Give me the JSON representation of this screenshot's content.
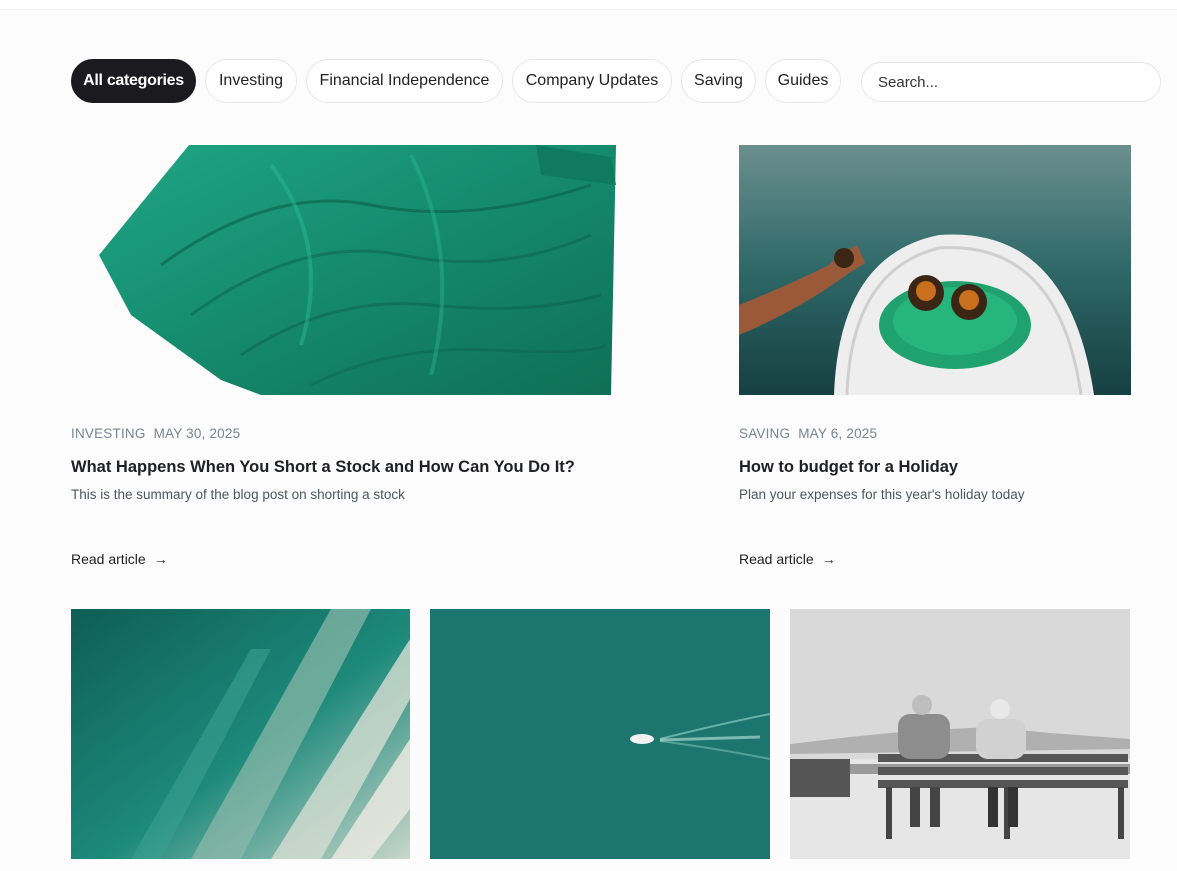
{
  "filters": {
    "categories": [
      "All categories",
      "Investing",
      "Financial Independence",
      "Company Updates",
      "Saving",
      "Guides"
    ],
    "active": "All categories"
  },
  "search": {
    "placeholder": "Search..."
  },
  "featured": [
    {
      "category": "INVESTING",
      "date": "MAY 30, 2025",
      "title": "What Happens When You Short a Stock and How Can You Do It?",
      "summary": "This is the summary of the blog post on shorting a stock",
      "link": "Read article"
    },
    {
      "category": "SAVING",
      "date": "MAY 6, 2025",
      "title": "How to budget for a Holiday",
      "summary": "Plan your expenses for this year's holiday today",
      "link": "Read article"
    }
  ],
  "icons": {
    "arrow": "→"
  },
  "colors": {
    "accent": "#1b1b1f",
    "teal": "#1e9e7e",
    "sea": "#2f6f70"
  }
}
